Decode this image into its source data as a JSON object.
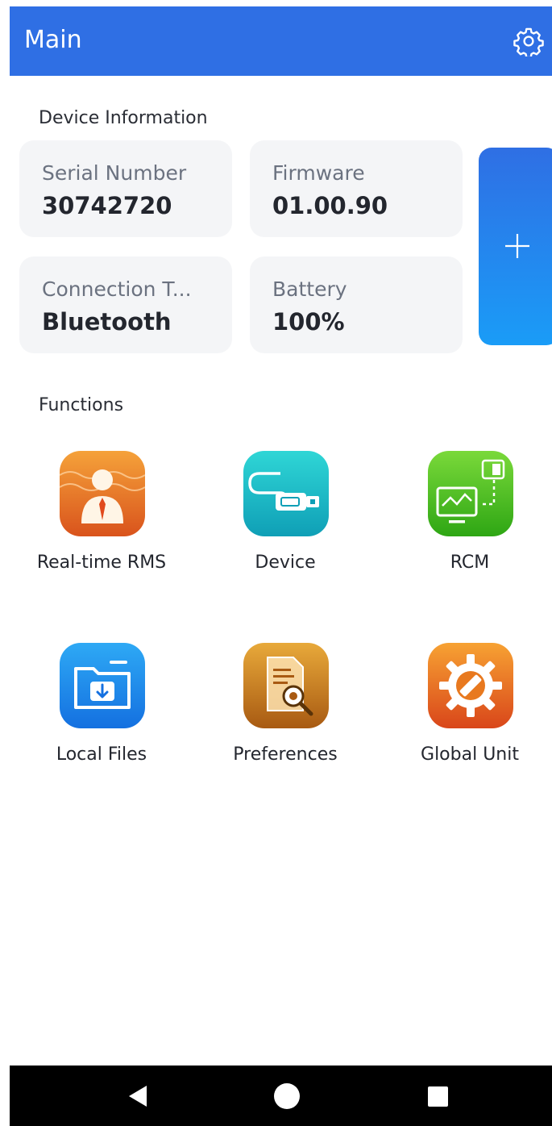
{
  "app_bar": {
    "title": "Main",
    "settings_icon": "gear-icon"
  },
  "device_info": {
    "heading": "Device Information",
    "cards": [
      {
        "label": "Serial Number",
        "value": "30742720"
      },
      {
        "label": "Firmware",
        "value": "01.00.90"
      },
      {
        "label": "Connection T...",
        "value": "Bluetooth"
      },
      {
        "label": "Battery",
        "value": "100%"
      }
    ],
    "add_icon": "plus-icon"
  },
  "functions": {
    "heading": "Functions",
    "items": [
      {
        "label": "Real-time RMS",
        "icon": "person-wave-icon"
      },
      {
        "label": "Device",
        "icon": "usb-cable-icon"
      },
      {
        "label": "RCM",
        "icon": "monitor-chart-icon"
      },
      {
        "label": "Local Files",
        "icon": "folder-download-icon"
      },
      {
        "label": "Preferences",
        "icon": "document-search-icon"
      },
      {
        "label": "Global Unit",
        "icon": "gear-ruler-icon"
      }
    ]
  },
  "nav_bar": {
    "back_icon": "back-triangle-icon",
    "home_icon": "home-circle-icon",
    "recents_icon": "recents-square-icon"
  },
  "colors": {
    "app_bar": "#2f6fe4",
    "card_bg": "#f4f5f7",
    "nav_bar": "#000000"
  }
}
